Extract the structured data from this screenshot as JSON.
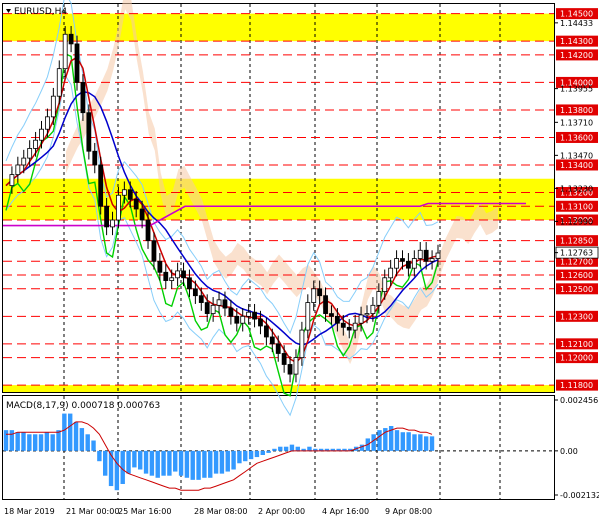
{
  "window_title": "EURUSD,H4",
  "colors": {
    "zone_yellow": "#ffff00",
    "level_red": "#ff0000",
    "level_box_red": "#e00000",
    "sky_blue": "#87cefa",
    "green": "#00d000",
    "blue": "#0000cc",
    "purple": "#cc00cc",
    "macd_bar": "#3399ff",
    "signal_red": "#cc0000"
  },
  "chart_data": [
    {
      "type": "line",
      "name": "EURUSD,H4 price chart",
      "ylim": [
        1.1175,
        1.1457
      ],
      "zones": [
        {
          "from": 1.143,
          "to": 1.145
        },
        {
          "from": 1.13,
          "to": 1.133
        },
        {
          "from": 1.1175,
          "to": 1.118
        }
      ],
      "levels": [
        "1.14500",
        "1.14300",
        "1.14200",
        "1.14000",
        "1.13800",
        "1.13600",
        "1.13400",
        "1.13200",
        "1.13100",
        "1.13000",
        "1.12850",
        "1.12700",
        "1.12600",
        "1.12500",
        "1.12300",
        "1.12100",
        "1.12000",
        "1.11800"
      ],
      "price_ticks": [
        "1.14433",
        "1.13955",
        "1.13710",
        "1.13470",
        "1.13230",
        "1.12990",
        "1.12763"
      ],
      "current_price": "1.12763",
      "x_labels": [
        "18 Mar 2019",
        "21 Mar 00:00",
        "25 Mar 16:00",
        "28 Mar 08:00",
        "2 Apr 00:00",
        "4 Apr 16:00",
        "9 Apr 08:00"
      ],
      "grid": true,
      "price_path": [
        1.1325,
        1.1333,
        1.134,
        1.1345,
        1.1352,
        1.1358,
        1.1366,
        1.1375,
        1.139,
        1.141,
        1.1435,
        1.1428,
        1.14,
        1.1378,
        1.135,
        1.134,
        1.131,
        1.1295,
        1.13,
        1.1318,
        1.1322,
        1.1315,
        1.1308,
        1.13,
        1.1285,
        1.127,
        1.1262,
        1.1256,
        1.1258,
        1.1263,
        1.1258,
        1.125,
        1.1245,
        1.124,
        1.1232,
        1.1238,
        1.1242,
        1.1236,
        1.123,
        1.1225,
        1.123,
        1.1233,
        1.1228,
        1.1223,
        1.1215,
        1.121,
        1.1203,
        1.1195,
        1.1188,
        1.12,
        1.122,
        1.124,
        1.125,
        1.1245,
        1.1232,
        1.123,
        1.1225,
        1.1222,
        1.122,
        1.1225,
        1.1231,
        1.1232,
        1.1238,
        1.1248,
        1.1258,
        1.1265,
        1.1272,
        1.127,
        1.1265,
        1.1272,
        1.1278,
        1.127,
        1.1272,
        1.1276
      ]
    },
    {
      "type": "bar",
      "name": "MACD panel",
      "indicator_label": "MACD(8,17,9) 0.000718 0.000763",
      "ylim": [
        -0.002132,
        0.002456
      ],
      "axis_labels": [
        "0.002456",
        "0.00",
        "-0.002132"
      ],
      "histogram": [
        0.001,
        0.001,
        0.0009,
        0.0009,
        0.0008,
        0.0008,
        0.0008,
        0.0009,
        0.0008,
        0.001,
        0.0018,
        0.0018,
        0.0014,
        0.0011,
        0.0008,
        0.0005,
        -0.0005,
        -0.0012,
        -0.0017,
        -0.0019,
        -0.0016,
        -0.0011,
        -0.0008,
        -0.0009,
        -0.0011,
        -0.0012,
        -0.0013,
        -0.0012,
        -0.0012,
        -0.001,
        -0.0012,
        -0.0013,
        -0.0014,
        -0.0014,
        -0.0013,
        -0.0013,
        -0.0011,
        -0.0011,
        -0.001,
        -0.0009,
        -0.0006,
        -0.0005,
        -0.0004,
        -0.0003,
        -0.0002,
        -0.0001,
        0.0001,
        0.0002,
        0.0002,
        0.0003,
        0.0002,
        0.0001,
        0.0002,
        0.0001,
        0.0001,
        0.0001,
        0.0001,
        0.0001,
        0.0001,
        0.0001,
        0.0002,
        0.0003,
        0.0006,
        0.0008,
        0.001,
        0.0011,
        0.0012,
        0.001,
        0.0009,
        0.0009,
        0.0008,
        0.0008,
        0.0007,
        0.0007
      ],
      "signal": [
        0.0008,
        0.0008,
        0.0009,
        0.0009,
        0.0009,
        0.0009,
        0.0009,
        0.0009,
        0.0009,
        0.0009,
        0.001,
        0.0012,
        0.0014,
        0.0014,
        0.0013,
        0.0011,
        0.0008,
        0.0003,
        -0.0002,
        -0.0006,
        -0.0009,
        -0.0011,
        -0.0012,
        -0.0013,
        -0.0014,
        -0.0015,
        -0.0016,
        -0.0017,
        -0.0018,
        -0.0018,
        -0.0019,
        -0.0019,
        -0.0019,
        -0.0019,
        -0.0018,
        -0.0018,
        -0.0017,
        -0.0016,
        -0.0015,
        -0.0014,
        -0.0012,
        -0.001,
        -0.0008,
        -0.0006,
        -0.0005,
        -0.0004,
        -0.0003,
        -0.0002,
        -0.0001,
        0.0,
        0.0,
        0.0,
        0.0,
        0.0,
        0.0,
        0.0,
        0.0,
        0.0,
        0.0,
        0.0,
        0.0001,
        0.0002,
        0.0003,
        0.0005,
        0.0007,
        0.0009,
        0.001,
        0.0011,
        0.0011,
        0.001,
        0.001,
        0.0009,
        0.0009,
        0.0008
      ]
    }
  ]
}
